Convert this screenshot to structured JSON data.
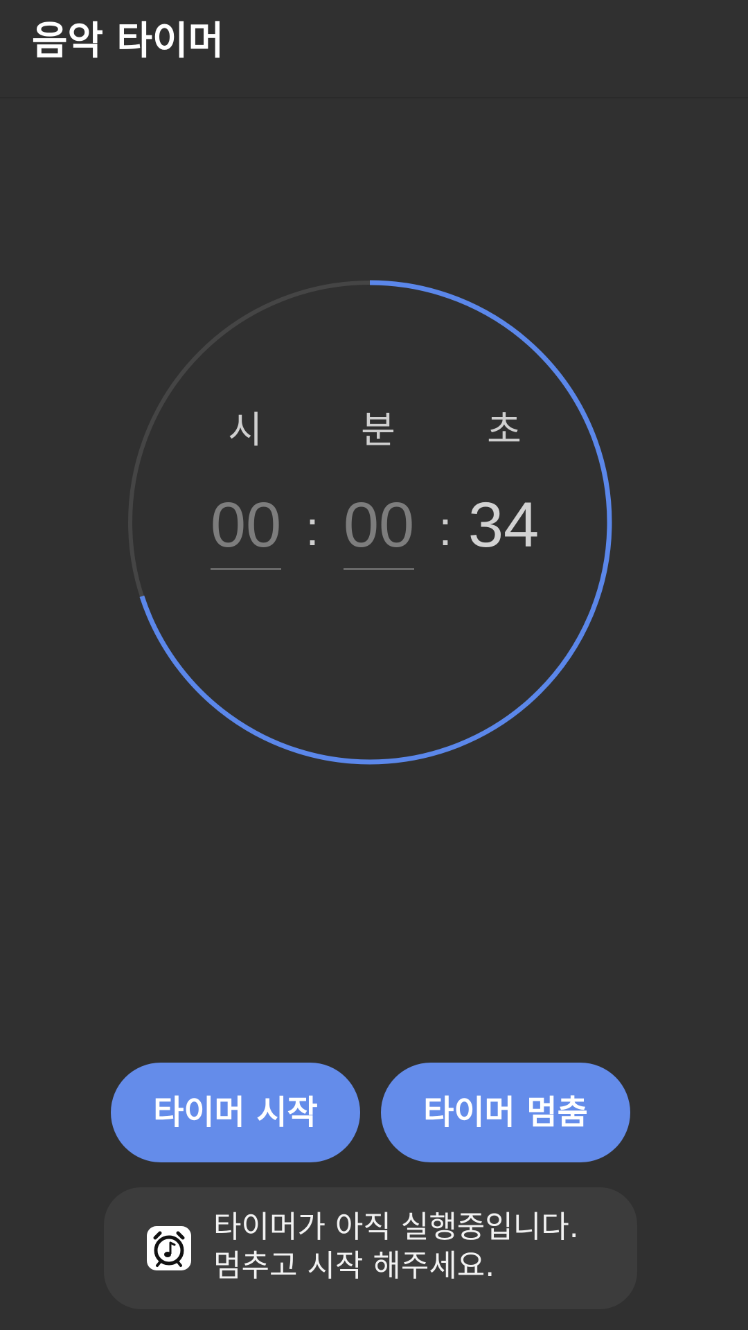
{
  "app_bar": {
    "title": "음악 타이머"
  },
  "timer": {
    "labels": {
      "hours": "시",
      "minutes": "분",
      "seconds": "초"
    },
    "hours": "00",
    "minutes": "00",
    "seconds": "34",
    "separator": ":",
    "progress_fraction": 0.7,
    "progress_color": "#5b87ea",
    "track_color": "#454545"
  },
  "buttons": {
    "start_label": "타이머 시작",
    "stop_label": "타이머 멈춤",
    "color": "#648cea"
  },
  "toast": {
    "icon": "music-alarm-icon",
    "line1": "타이머가 아직 실행중입니다.",
    "line2": "멈추고 시작 해주세요."
  }
}
